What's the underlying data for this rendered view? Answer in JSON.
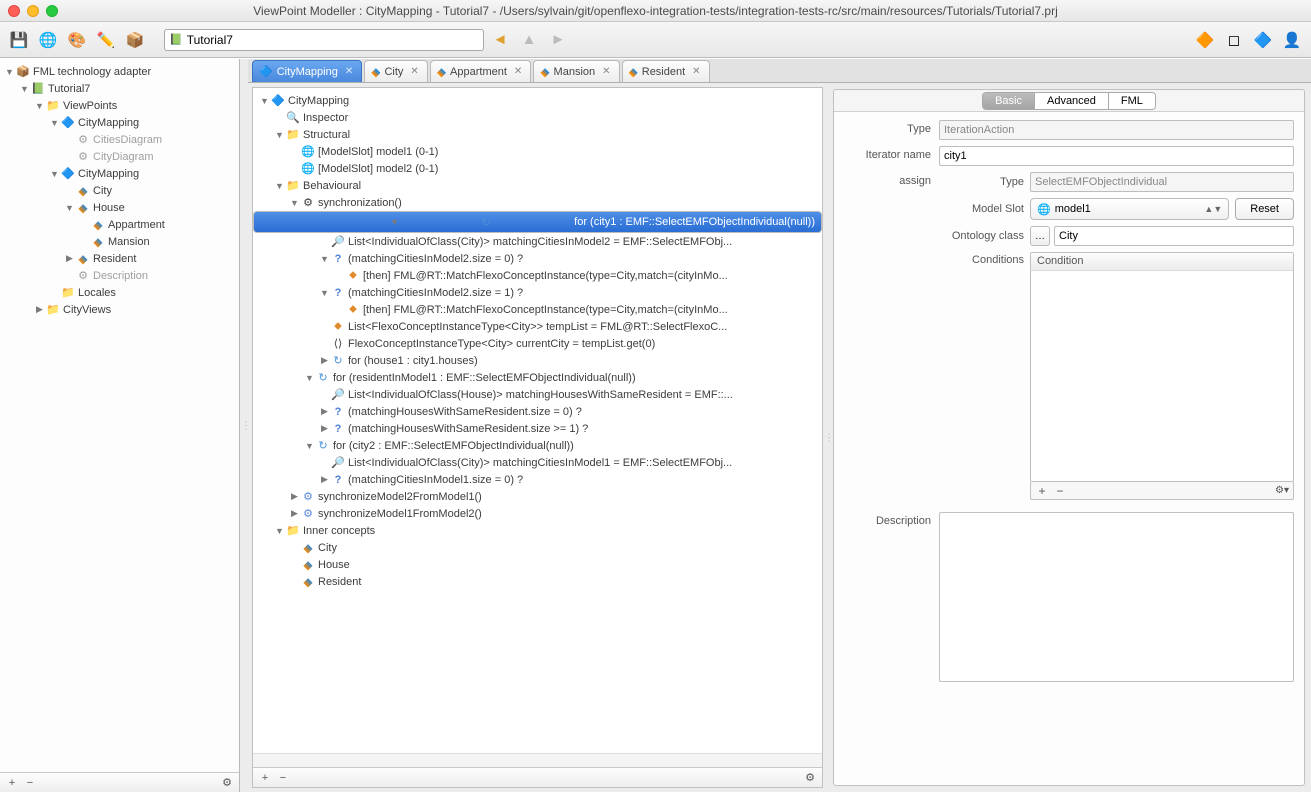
{
  "window": {
    "title": "ViewPoint Modeller : CityMapping - Tutorial7 - /Users/sylvain/git/openflexo-integration-tests/integration-tests-rc/src/main/resources/Tutorials/Tutorial7.prj"
  },
  "toolbar": {
    "address": "Tutorial7"
  },
  "leftTree": [
    {
      "d": 0,
      "tw": "▼",
      "ic": "📦",
      "lbl": "FML technology adapter",
      "int": true
    },
    {
      "d": 1,
      "tw": "▼",
      "ic": "📗",
      "lbl": "Tutorial7",
      "int": true
    },
    {
      "d": 2,
      "tw": "▼",
      "ic": "📁",
      "lbl": "ViewPoints",
      "int": true
    },
    {
      "d": 3,
      "tw": "▼",
      "ic": "🔷",
      "lbl": "CityMapping",
      "int": true
    },
    {
      "d": 4,
      "tw": "",
      "ic": "⚙",
      "lbl": "CitiesDiagram",
      "dim": true,
      "int": true
    },
    {
      "d": 4,
      "tw": "",
      "ic": "⚙",
      "lbl": "CityDiagram",
      "dim": true,
      "int": true
    },
    {
      "d": 3,
      "tw": "▼",
      "ic": "🔷",
      "lbl": "CityMapping",
      "int": true
    },
    {
      "d": 4,
      "tw": "",
      "ic": "◆",
      "lbl": "City",
      "cls": "i-diamond",
      "int": true
    },
    {
      "d": 4,
      "tw": "▼",
      "ic": "◆",
      "lbl": "House",
      "cls": "i-diamond",
      "int": true
    },
    {
      "d": 5,
      "tw": "",
      "ic": "◆",
      "lbl": "Appartment",
      "cls": "i-diamond",
      "int": true
    },
    {
      "d": 5,
      "tw": "",
      "ic": "◆",
      "lbl": "Mansion",
      "cls": "i-diamond",
      "int": true
    },
    {
      "d": 4,
      "tw": "▶",
      "ic": "◆",
      "lbl": "Resident",
      "cls": "i-diamond",
      "int": true
    },
    {
      "d": 4,
      "tw": "",
      "ic": "⚙",
      "lbl": "Description",
      "dim": true,
      "int": true
    },
    {
      "d": 3,
      "tw": "",
      "ic": "📁",
      "lbl": "Locales",
      "int": true
    },
    {
      "d": 2,
      "tw": "▶",
      "ic": "📁",
      "lbl": "CityViews",
      "int": true
    }
  ],
  "tabs": [
    {
      "ic": "🔷",
      "lbl": "CityMapping",
      "active": true
    },
    {
      "ic": "◆",
      "lbl": "City"
    },
    {
      "ic": "◆",
      "lbl": "Appartment"
    },
    {
      "ic": "◆",
      "lbl": "Mansion"
    },
    {
      "ic": "◆",
      "lbl": "Resident"
    }
  ],
  "editorTree": [
    {
      "d": 0,
      "tw": "▼",
      "ic": "🔷",
      "lbl": "CityMapping"
    },
    {
      "d": 1,
      "tw": "",
      "ic": "🔍",
      "lbl": "Inspector",
      "cls": "i-search"
    },
    {
      "d": 1,
      "tw": "▼",
      "ic": "📁",
      "lbl": "Structural"
    },
    {
      "d": 2,
      "tw": "",
      "ic": "🌐",
      "lbl": "[ModelSlot] model1 (0-1)"
    },
    {
      "d": 2,
      "tw": "",
      "ic": "🌐",
      "lbl": "[ModelSlot] model2 (0-1)"
    },
    {
      "d": 1,
      "tw": "▼",
      "ic": "📁",
      "lbl": "Behavioural"
    },
    {
      "d": 2,
      "tw": "▼",
      "ic": "⚙",
      "lbl": "synchronization()"
    },
    {
      "d": 3,
      "tw": "▼",
      "ic": "↻",
      "lbl": "for (city1 : EMF::SelectEMFObjectIndividual(null))",
      "sel": true,
      "cls": "i-loop"
    },
    {
      "d": 4,
      "tw": "",
      "ic": "🔎",
      "lbl": "List<IndividualOfClass(City)> matchingCitiesInModel2 = EMF::SelectEMFObj..."
    },
    {
      "d": 4,
      "tw": "▼",
      "ic": "?",
      "lbl": "(matchingCitiesInModel2.size = 0) ?",
      "cls": "i-q"
    },
    {
      "d": 5,
      "tw": "",
      "ic": "⬥",
      "lbl": "[then] FML@RT::MatchFlexoConceptInstance(type=City,match=(cityInMo...",
      "cls": "i-orange"
    },
    {
      "d": 4,
      "tw": "▼",
      "ic": "?",
      "lbl": "(matchingCitiesInModel2.size = 1) ?",
      "cls": "i-q"
    },
    {
      "d": 5,
      "tw": "",
      "ic": "⬥",
      "lbl": "[then] FML@RT::MatchFlexoConceptInstance(type=City,match=(cityInMo...",
      "cls": "i-orange"
    },
    {
      "d": 4,
      "tw": "",
      "ic": "⬥",
      "lbl": "List<FlexoConceptInstanceType<City>> tempList = FML@RT::SelectFlexoC...",
      "cls": "i-orange"
    },
    {
      "d": 4,
      "tw": "",
      "ic": "⟨⟩",
      "lbl": "FlexoConceptInstanceType<City> currentCity = tempList.get(0)"
    },
    {
      "d": 4,
      "tw": "▶",
      "ic": "↻",
      "lbl": "for (house1 : city1.houses)",
      "cls": "i-loop"
    },
    {
      "d": 3,
      "tw": "▼",
      "ic": "↻",
      "lbl": "for (residentInModel1 : EMF::SelectEMFObjectIndividual(null))",
      "cls": "i-loop"
    },
    {
      "d": 4,
      "tw": "",
      "ic": "🔎",
      "lbl": "List<IndividualOfClass(House)> matchingHousesWithSameResident = EMF::..."
    },
    {
      "d": 4,
      "tw": "▶",
      "ic": "?",
      "lbl": "(matchingHousesWithSameResident.size = 0) ?",
      "cls": "i-q"
    },
    {
      "d": 4,
      "tw": "▶",
      "ic": "?",
      "lbl": "(matchingHousesWithSameResident.size >= 1) ?",
      "cls": "i-q"
    },
    {
      "d": 3,
      "tw": "▼",
      "ic": "↻",
      "lbl": "for (city2 : EMF::SelectEMFObjectIndividual(null))",
      "cls": "i-loop"
    },
    {
      "d": 4,
      "tw": "",
      "ic": "🔎",
      "lbl": "List<IndividualOfClass(City)> matchingCitiesInModel1 = EMF::SelectEMFObj..."
    },
    {
      "d": 4,
      "tw": "▶",
      "ic": "?",
      "lbl": "(matchingCitiesInModel1.size = 0) ?",
      "cls": "i-q"
    },
    {
      "d": 2,
      "tw": "▶",
      "ic": "⚙",
      "lbl": "synchronizeModel2FromModel1()",
      "cls": "i-blue"
    },
    {
      "d": 2,
      "tw": "▶",
      "ic": "⚙",
      "lbl": "synchronizeModel1FromModel2()",
      "cls": "i-blue"
    },
    {
      "d": 1,
      "tw": "▼",
      "ic": "📁",
      "lbl": "Inner concepts"
    },
    {
      "d": 2,
      "tw": "",
      "ic": "◆",
      "lbl": "City",
      "cls": "i-diamond"
    },
    {
      "d": 2,
      "tw": "",
      "ic": "◆",
      "lbl": "House",
      "cls": "i-diamond"
    },
    {
      "d": 2,
      "tw": "",
      "ic": "◆",
      "lbl": "Resident",
      "cls": "i-diamond"
    }
  ],
  "inspector": {
    "tabs": {
      "basic": "Basic",
      "advanced": "Advanced",
      "fml": "FML"
    },
    "type_label": "Type",
    "type_value": "IterationAction",
    "iterator_label": "Iterator name",
    "iterator_value": "city1",
    "assign_label": "assign",
    "sub_type_label": "Type",
    "sub_type_value": "SelectEMFObjectIndividual",
    "modelslot_label": "Model Slot",
    "modelslot_value": "model1",
    "reset_label": "Reset",
    "ontology_label": "Ontology class",
    "ontology_value": "City",
    "conditions_label": "Conditions",
    "conditions_header": "Condition",
    "description_label": "Description"
  }
}
